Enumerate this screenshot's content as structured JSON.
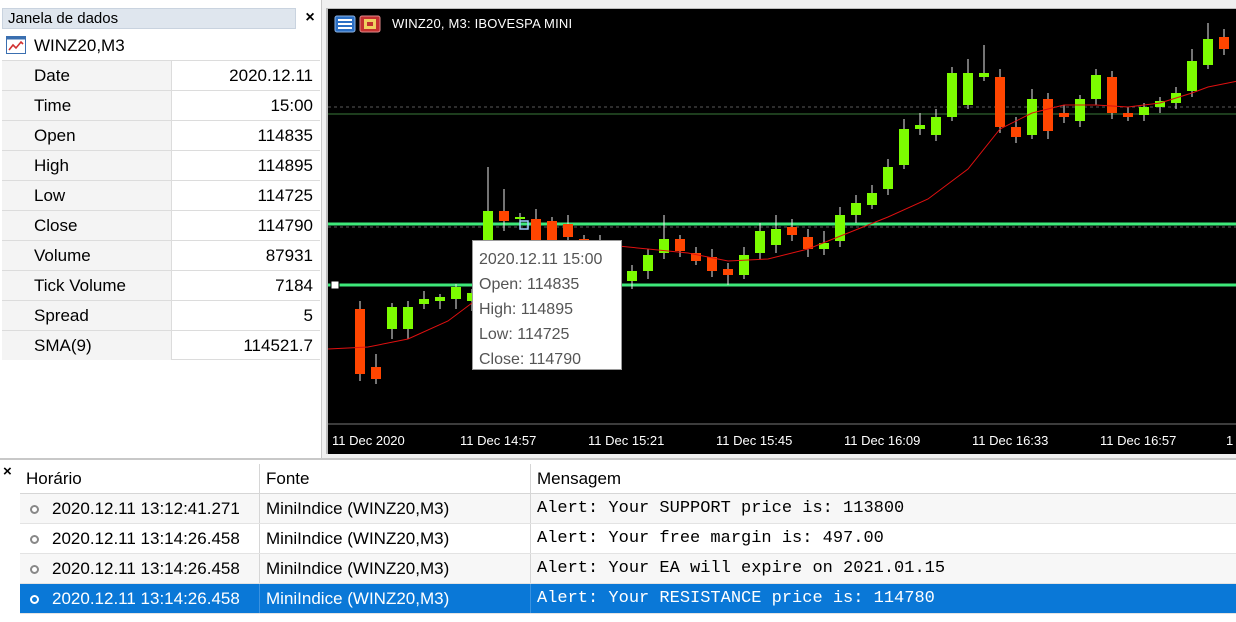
{
  "data_window": {
    "title": "Janela de dados",
    "close_glyph": "×",
    "symbol": "WINZ20,M3",
    "rows": [
      {
        "key": "Date",
        "value": "2020.12.11"
      },
      {
        "key": "Time",
        "value": "15:00"
      },
      {
        "key": "Open",
        "value": "114835"
      },
      {
        "key": "High",
        "value": "114895"
      },
      {
        "key": "Low",
        "value": "114725"
      },
      {
        "key": "Close",
        "value": "114790"
      },
      {
        "key": "Volume",
        "value": "87931"
      },
      {
        "key": "Tick Volume",
        "value": "7184"
      },
      {
        "key": "Spread",
        "value": "5"
      },
      {
        "key": "SMA(9)",
        "value": "114521.7"
      }
    ]
  },
  "chart": {
    "title": "WINZ20, M3:  IBOVESPA MINI",
    "bull_color": "#7cfc00",
    "bear_color": "#ff4500",
    "sma_color": "#e01010",
    "hline_color": "#3ee87a",
    "x_ticks": [
      "11 Dec 2020",
      "11 Dec 14:57",
      "11 Dec 15:21",
      "11 Dec 15:45",
      "11 Dec 16:09",
      "11 Dec 16:33",
      "11 Dec 16:57",
      "1"
    ]
  },
  "tooltip": {
    "date": "2020.12.11 15:00",
    "open": "Open: 114835",
    "high": "High: 114895",
    "low": "Low: 114725",
    "close": "Close: 114790"
  },
  "alerts": {
    "close_glyph": "×",
    "columns": {
      "time": "Horário",
      "source": "Fonte",
      "message": "Mensagem"
    },
    "rows": [
      {
        "time": "2020.12.11 13:12:41.271",
        "source": "MiniIndice (WINZ20,M3)",
        "message": "Alert: Your SUPPORT price is: 113800"
      },
      {
        "time": "2020.12.11 13:14:26.458",
        "source": "MiniIndice (WINZ20,M3)",
        "message": "Alert: Your free margin is: 497.00"
      },
      {
        "time": "2020.12.11 13:14:26.458",
        "source": "MiniIndice (WINZ20,M3)",
        "message": "Alert: Your EA will expire on 2021.01.15"
      },
      {
        "time": "2020.12.11 13:14:26.458",
        "source": "MiniIndice (WINZ20,M3)",
        "message": "Alert: Your RESISTANCE price is: 114780"
      }
    ],
    "selected_index": 3
  }
}
